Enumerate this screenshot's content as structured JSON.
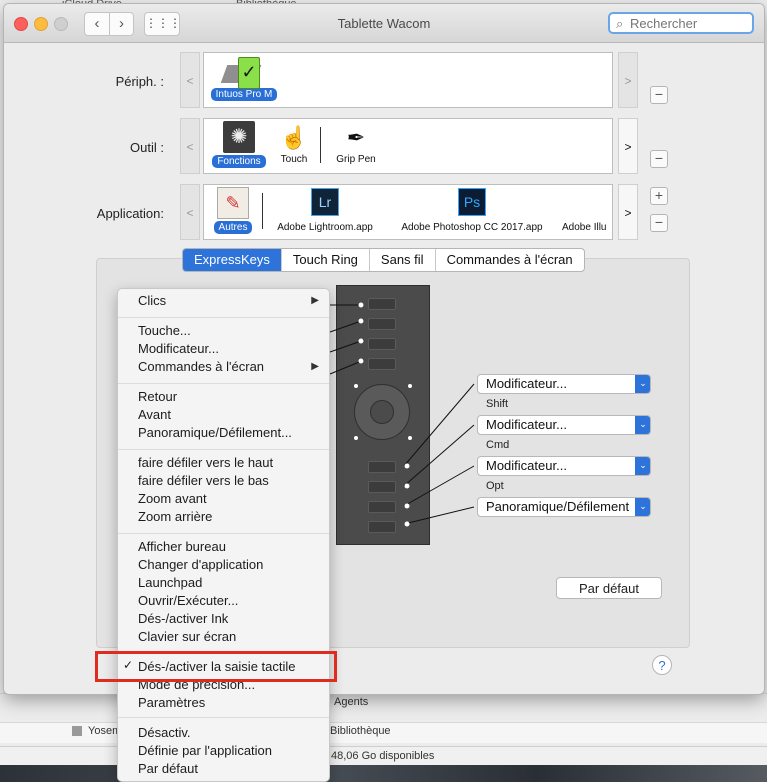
{
  "background": {
    "finder_items": [
      "iCloud Drive",
      "Bibliothèque",
      "Agents",
      "Yosemite",
      "Bibliothèque"
    ],
    "status": "48,06 Go disponibles"
  },
  "window": {
    "title": "Tablette Wacom",
    "search_placeholder": "Rechercher"
  },
  "rows": {
    "device": {
      "label": "Périph. :",
      "items": [
        {
          "name": "Intuos Pro M"
        }
      ]
    },
    "tool": {
      "label": "Outil :",
      "items": [
        {
          "name": "Fonctions"
        },
        {
          "name": "Touch"
        },
        {
          "name": "Grip Pen"
        }
      ]
    },
    "app": {
      "label": "Application:",
      "items": [
        {
          "name": "Autres"
        },
        {
          "name": "Adobe Lightroom.app",
          "badge": "Lr"
        },
        {
          "name": "Adobe Photoshop CC 2017.app",
          "badge": "Ps"
        },
        {
          "name": "Adobe Illu"
        }
      ]
    }
  },
  "tabs": [
    {
      "label": "ExpressKeys",
      "active": true
    },
    {
      "label": "Touch Ring",
      "active": false
    },
    {
      "label": "Sans fil",
      "active": false
    },
    {
      "label": "Commandes à l'écran",
      "active": false
    }
  ],
  "key_settings": [
    {
      "value": "Modificateur...",
      "modifier": "Shift"
    },
    {
      "value": "Modificateur...",
      "modifier": "Cmd"
    },
    {
      "value": "Modificateur...",
      "modifier": "Opt"
    },
    {
      "value": "Panoramique/Défilement",
      "modifier": ""
    }
  ],
  "default_button": "Par défaut",
  "help_label": "?",
  "menu": {
    "groups": [
      [
        {
          "label": "Clics",
          "submenu": true
        }
      ],
      [
        {
          "label": "Touche..."
        },
        {
          "label": "Modificateur..."
        },
        {
          "label": "Commandes à l'écran",
          "submenu": true
        }
      ],
      [
        {
          "label": "Retour"
        },
        {
          "label": "Avant"
        },
        {
          "label": "Panoramique/Défilement..."
        }
      ],
      [
        {
          "label": "faire défiler vers le haut"
        },
        {
          "label": "faire défiler vers le bas"
        },
        {
          "label": "Zoom avant"
        },
        {
          "label": "Zoom arrière"
        }
      ],
      [
        {
          "label": "Afficher bureau"
        },
        {
          "label": "Changer d'application"
        },
        {
          "label": "Launchpad"
        },
        {
          "label": "Ouvrir/Exécuter..."
        },
        {
          "label": "Dés-/activer Ink"
        },
        {
          "label": "Clavier sur écran"
        }
      ],
      [
        {
          "label": "Dés-/activer la saisie tactile",
          "checked": true
        },
        {
          "label": "Mode de précision..."
        },
        {
          "label": "Paramètres"
        }
      ],
      [
        {
          "label": "Désactiv."
        },
        {
          "label": "Définie par l'application"
        },
        {
          "label": "Par défaut"
        }
      ]
    ]
  },
  "colors": {
    "accent": "#2d73d9",
    "highlight_box": "#e02b1f",
    "tablet": "#4b4b4b"
  }
}
